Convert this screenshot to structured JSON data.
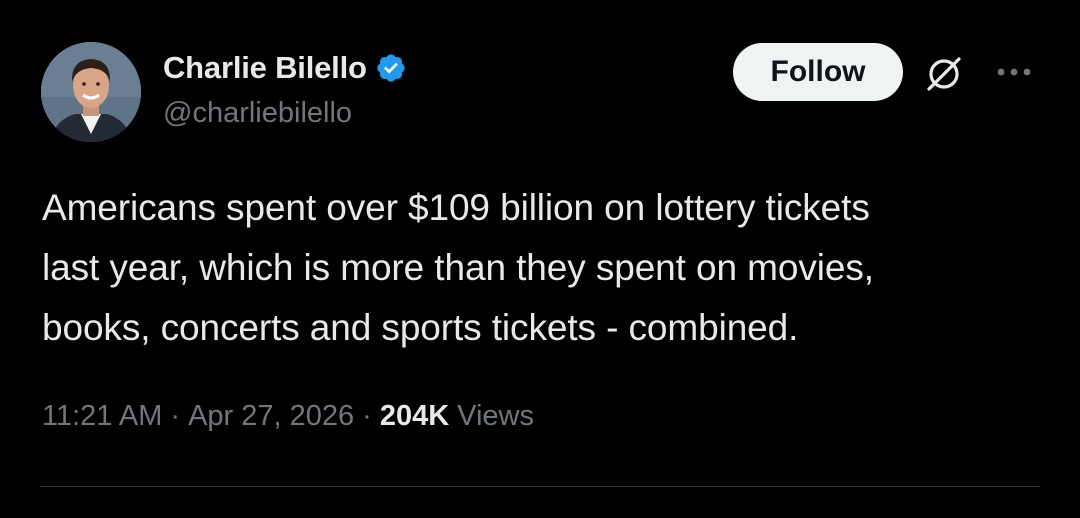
{
  "author": {
    "display_name": "Charlie Bilello",
    "handle": "@charliebilello",
    "avatar_icon": "profile-photo",
    "verified_icon": "verified-badge-icon",
    "verified_color": "#1d9bf0"
  },
  "actions": {
    "follow_label": "Follow",
    "grok_icon": "grok-icon",
    "more_icon": "more-icon"
  },
  "tweet": {
    "text": "Americans spent over $109 billion on lottery tickets\nlast year, which is more than they spent on movies,\nbooks, concerts and sports tickets - combined."
  },
  "meta": {
    "time": "11:21 AM",
    "separator": "·",
    "date": "Apr 27, 2026",
    "views_count": "204K",
    "views_label": "Views"
  },
  "colors": {
    "background": "#000000",
    "primary_text": "#e7e9ea",
    "secondary_text": "#71767b",
    "follow_button_bg": "#eff3f4",
    "divider": "#2f3336"
  }
}
